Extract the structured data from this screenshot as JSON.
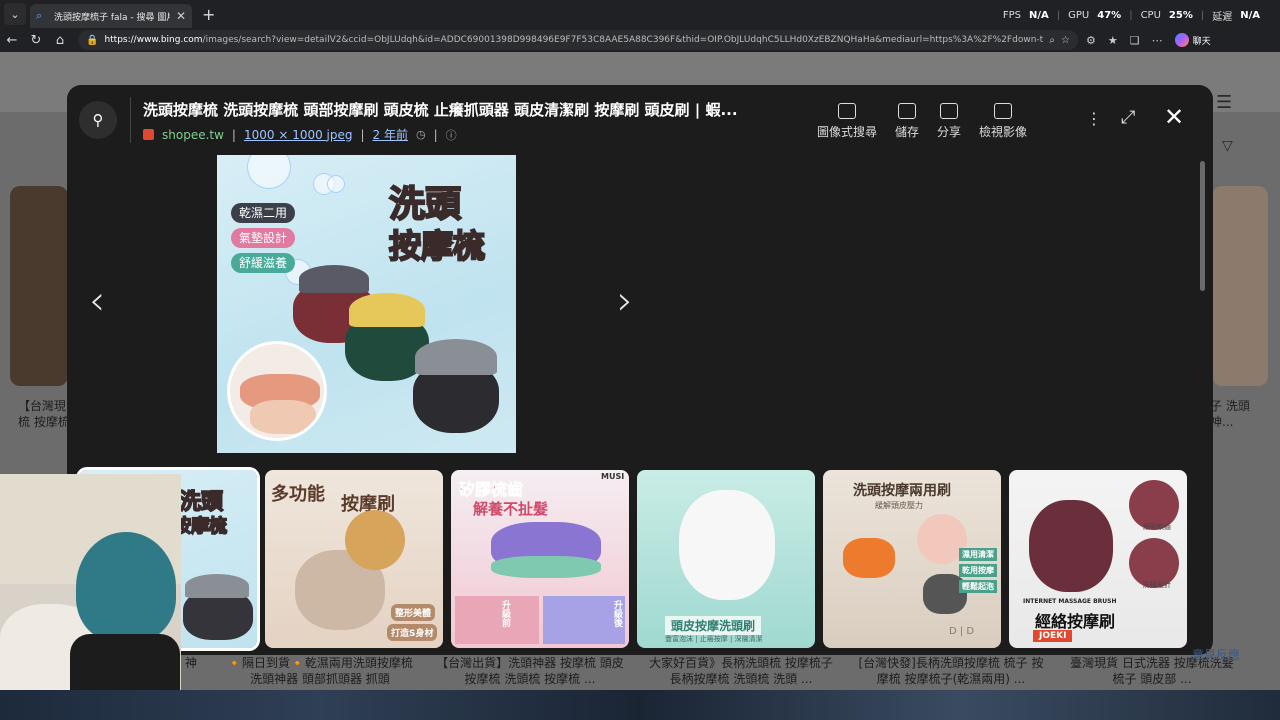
{
  "browser": {
    "tab_title": "洗頭按摩梳子 fala - 搜尋 圖片",
    "url_host": "https://www.bing.com",
    "url_path": "/images/search?view=detailV2&ccid=ObJLUdqh&id=ADDC69001398D998496E9F7F53C8AAE5A88C396F&thid=OIP.ObJLUdqhC5LLHd0XzEBZNQHaHa&mediaurl=https%3A%2F%2Fdown-tw.img.susercontent.com...",
    "copilot_label": "聊天"
  },
  "hud": {
    "fps_label": "FPS",
    "fps_value": "N/A",
    "gpu_label": "GPU",
    "gpu_value": "47%",
    "cpu_label": "CPU",
    "cpu_value": "25%",
    "lat_label": "延遲",
    "lat_value": "N/A"
  },
  "modal": {
    "title": "洗頭按摩梳 洗頭按摩梳 頭部按摩刷 頭皮梳 止癢抓頭器 頭皮清潔刷 按摩刷 頭皮刷 | 蝦...",
    "source": "shopee.tw",
    "dimensions": "1000 × 1000 jpeg",
    "age": "2 年前",
    "actions": [
      {
        "label": "圖像式搜尋",
        "icon": "visual-search-icon"
      },
      {
        "label": "儲存",
        "icon": "save-icon"
      },
      {
        "label": "分享",
        "icon": "share-icon"
      },
      {
        "label": "檢視影像",
        "icon": "view-image-icon"
      }
    ],
    "image_text": {
      "big_line1": "洗頭",
      "big_line2": "按摩梳",
      "pill1": "乾濕二用",
      "pill2": "氣墊設計",
      "pill3": "舒緩滋養"
    }
  },
  "thumbs": [
    {
      "t1": "洗頭",
      "t2": "按摩梳"
    },
    {
      "t1": "多功能",
      "t2": "按摩刷",
      "t3": "整形美體",
      "t4": "打造S身材"
    },
    {
      "t1": "矽膠梳齒",
      "t2": "解養不扯髮",
      "t3": "升級前",
      "t4": "升級後",
      "t5": "MUSI"
    },
    {
      "t1": "頭皮按摩洗頭刷",
      "t2": "豐富泡沫 | 止癢按摩 | 深層清潔"
    },
    {
      "t1": "洗頭按摩兩用刷",
      "t2": "緩解頭皮壓力",
      "t3": "濕用清潔",
      "t4": "乾用按摩",
      "t5": "輕鬆起泡",
      "t6": "D | D"
    },
    {
      "t1": "INTERNET MASSAGE BRUSH",
      "t2": "經絡按摩刷",
      "t3": "JOEKI",
      "t4": "細密軟齒",
      "t5": "防掉設計"
    }
  ],
  "background": {
    "left_caption": "【台灣現\n梳 按摩梳",
    "right_caption": "子 洗頭\n神...",
    "feedback": "意見反應",
    "bottom_captions": [
      "神",
      "🔸隔日到貨🔸乾濕兩用洗頭按摩梳 洗頭神器 頭部抓頭器 抓頭",
      "【台灣出貨】洗頭神器 按摩梳 頭皮按摩梳 洗頭梳 按摩梳 ...",
      "大家好百貨》長柄洗頭梳 按摩梳子 長柄按摩梳 洗頭梳 洗頭 ...",
      "[台灣快發]長柄洗頭按摩梳 梳子 按摩梳 按摩梳子(乾濕兩用) ...",
      "臺灣現貨 日式洗器 按摩梳洗髮梳子 頭皮部 ..."
    ]
  }
}
